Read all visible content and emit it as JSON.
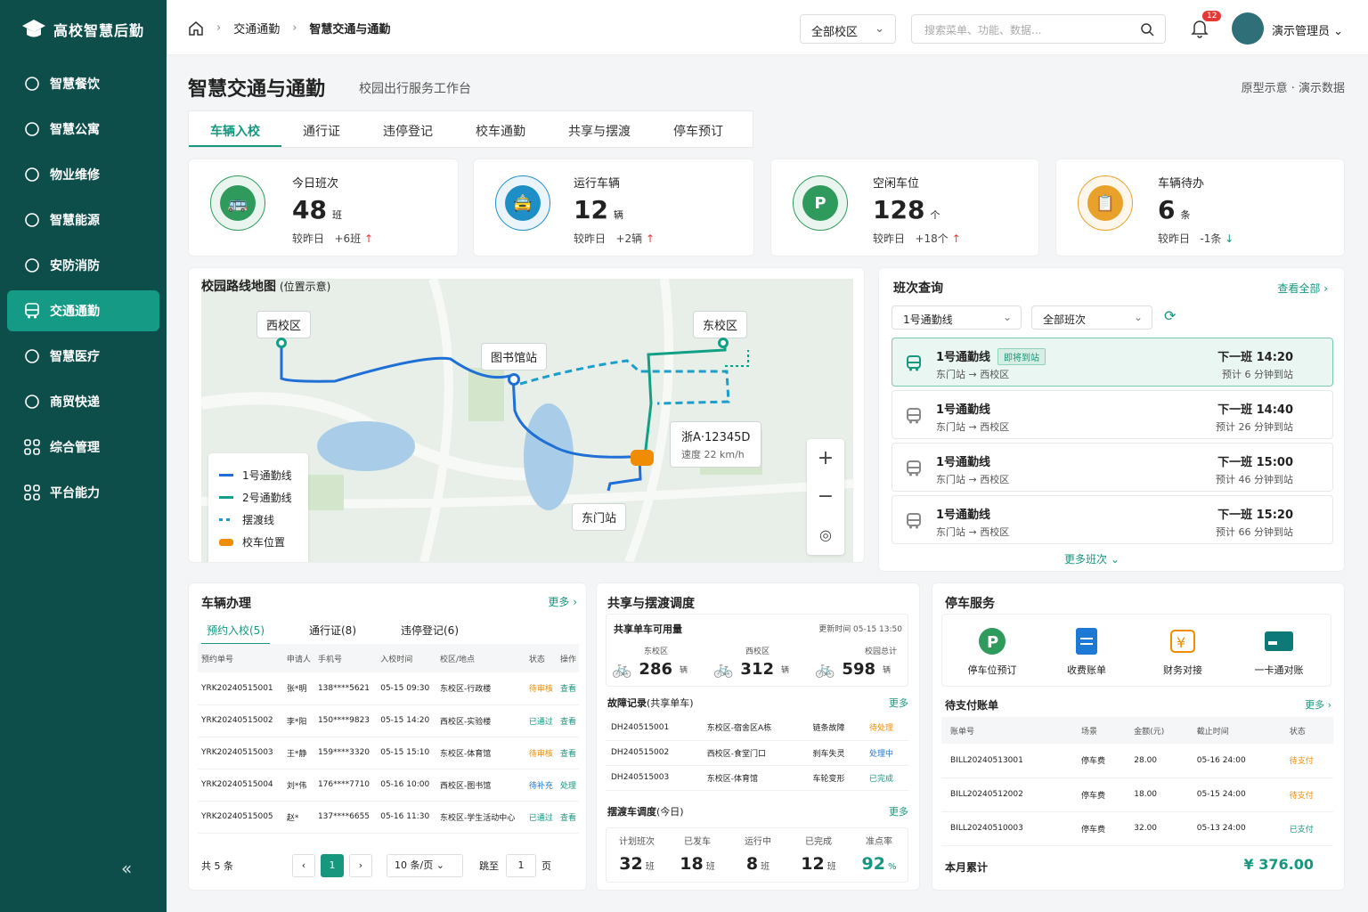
{
  "app": {
    "name": "高校智慧后勤"
  },
  "sidebar": {
    "items": [
      {
        "label": "智慧餐饮",
        "icon": "dining-icon"
      },
      {
        "label": "智慧公寓",
        "icon": "building-icon"
      },
      {
        "label": "物业维修",
        "icon": "wrench-icon"
      },
      {
        "label": "智慧能源",
        "icon": "energy-icon"
      },
      {
        "label": "安防消防",
        "icon": "shield-icon"
      },
      {
        "label": "交通通勤",
        "icon": "bus-icon",
        "active": true
      },
      {
        "label": "智慧医疗",
        "icon": "medical-icon"
      },
      {
        "label": "商贸快递",
        "icon": "cart-icon"
      },
      {
        "label": "综合管理",
        "icon": "grid-icon"
      },
      {
        "label": "平台能力",
        "icon": "grid-icon"
      }
    ],
    "collapse": "«"
  },
  "topbar": {
    "breadcrumb": [
      "交通通勤",
      "智慧交通与通勤"
    ],
    "campus": "全部校区",
    "search_placeholder": "搜索菜单、功能、数据...",
    "notifications": "12",
    "user": "演示管理员"
  },
  "page": {
    "title": "智慧交通与通勤",
    "subtitle": "校园出行服务工作台",
    "right": "原型示意 · 演示数据"
  },
  "tabs": [
    "车辆入校",
    "通行证",
    "违停登记",
    "校车通勤",
    "共享与摆渡",
    "停车预订"
  ],
  "stats": [
    {
      "label": "今日班次",
      "value": "48",
      "unit": "班",
      "compare_label": "较昨日",
      "compare": "+6班",
      "trend": "up",
      "color": "#2e9a5b"
    },
    {
      "label": "运行车辆",
      "value": "12",
      "unit": "辆",
      "compare_label": "较昨日",
      "compare": "+2辆",
      "trend": "up",
      "color": "#1e8fc6"
    },
    {
      "label": "空闲车位",
      "value": "128",
      "unit": "个",
      "compare_label": "较昨日",
      "compare": "+18个",
      "trend": "up",
      "color": "#2e9a5b"
    },
    {
      "label": "车辆待办",
      "value": "6",
      "unit": "条",
      "compare_label": "较昨日",
      "compare": "-1条",
      "trend": "down",
      "color": "#e8a12a"
    }
  ],
  "map": {
    "title": "校园路线地图",
    "note": "(位置示意)",
    "labels": {
      "west": "西校区",
      "east": "东校区",
      "library": "图书馆站",
      "gate": "东门站"
    },
    "vehicle": {
      "plate": "浙A·12345D",
      "speed": "速度 22 km/h"
    },
    "legend": [
      "1号通勤线",
      "2号通勤线",
      "摆渡线",
      "校车位置"
    ]
  },
  "shift": {
    "title": "班次查询",
    "more": "查看全部",
    "line_sel": "1号通勤线",
    "all_sel": "全部班次",
    "more_shifts": "更多班次",
    "routes": [
      {
        "name": "1号通勤线",
        "tag": "即将到站",
        "path": "东门站 → 西校区",
        "next": "下一班  14:20",
        "eta": "预计 6 分钟到站"
      },
      {
        "name": "1号通勤线",
        "tag": "",
        "path": "东门站 → 西校区",
        "next": "下一班  14:40",
        "eta": "预计 26 分钟到站"
      },
      {
        "name": "1号通勤线",
        "tag": "",
        "path": "东门站 → 西校区",
        "next": "下一班  15:00",
        "eta": "预计 46 分钟到站"
      },
      {
        "name": "1号通勤线",
        "tag": "",
        "path": "东门站 → 西校区",
        "next": "下一班  15:20",
        "eta": "预计 66 分钟到站"
      }
    ]
  },
  "vehicle": {
    "title": "车辆办理",
    "more": "更多",
    "tabs": [
      "预约入校(5)",
      "通行证(8)",
      "违停登记(6)"
    ],
    "headers": [
      "预约单号",
      "申请人",
      "手机号",
      "入校时间",
      "校区/地点",
      "状态",
      "操作"
    ],
    "rows": [
      [
        "YRK20240515001",
        "张*明",
        "138****5621",
        "05-15 09:30",
        "东校区-行政楼",
        "待审核",
        "查看"
      ],
      [
        "YRK20240515002",
        "李*阳",
        "150****9823",
        "05-15 14:20",
        "西校区-实验楼",
        "已通过",
        "查看"
      ],
      [
        "YRK20240515003",
        "王*静",
        "159****3320",
        "05-15 15:10",
        "东校区-体育馆",
        "待审核",
        "查看"
      ],
      [
        "YRK20240515004",
        "刘*伟",
        "176****7710",
        "05-16 10:00",
        "西校区-图书馆",
        "待补充",
        "处理"
      ],
      [
        "YRK20240515005",
        "赵*",
        "137****6655",
        "05-16 11:30",
        "东校区-学生活动中心",
        "已通过",
        "查看"
      ]
    ],
    "total": "共 5 条",
    "page": "1",
    "page_size": "10 条/页",
    "jump": "跳至",
    "jump_val": "1",
    "page_unit": "页"
  },
  "sharing": {
    "title": "共享与摆渡调度",
    "avail_title": "共享单车可用量",
    "updated": "更新时间 05-15 13:50",
    "avail": [
      {
        "label": "东校区",
        "value": "286",
        "unit": "辆"
      },
      {
        "label": "西校区",
        "value": "312",
        "unit": "辆"
      },
      {
        "label": "校园总计",
        "value": "598",
        "unit": "辆"
      }
    ],
    "fault_title": "故障记录",
    "fault_note": "(共享单车)",
    "fault_more": "更多",
    "faults": [
      [
        "DH240515001",
        "东校区-宿舍区A栋",
        "链条故障",
        "待处理"
      ],
      [
        "DH240515002",
        "西校区-食堂门口",
        "刹车失灵",
        "处理中"
      ],
      [
        "DH240515003",
        "东校区-体育馆",
        "车轮变形",
        "已完成"
      ]
    ],
    "shuttle_title": "摆渡车调度",
    "shuttle_note": "(今日)",
    "shuttle_more": "更多",
    "shuttle": [
      {
        "label": "计划班次",
        "value": "32",
        "unit": "班"
      },
      {
        "label": "已发车",
        "value": "18",
        "unit": "班"
      },
      {
        "label": "运行中",
        "value": "8",
        "unit": "班"
      },
      {
        "label": "已完成",
        "value": "12",
        "unit": "班"
      },
      {
        "label": "准点率",
        "value": "92",
        "unit": "%"
      }
    ]
  },
  "parking": {
    "title": "停车服务",
    "services": [
      "停车位预订",
      "收费账单",
      "财务对接",
      "一卡通对账"
    ],
    "bills_title": "待支付账单",
    "bills_more": "更多",
    "headers": [
      "账单号",
      "场景",
      "金额(元)",
      "截止时间",
      "状态"
    ],
    "bills": [
      [
        "BILL20240513001",
        "停车费",
        "28.00",
        "05-16 24:00",
        "待支付"
      ],
      [
        "BILL20240512002",
        "停车费",
        "18.00",
        "05-15 24:00",
        "待支付"
      ],
      [
        "BILL20240510003",
        "停车费",
        "32.00",
        "05-13 24:00",
        "已支付"
      ]
    ],
    "total_label": "本月累计",
    "total": "¥ 376.00"
  }
}
